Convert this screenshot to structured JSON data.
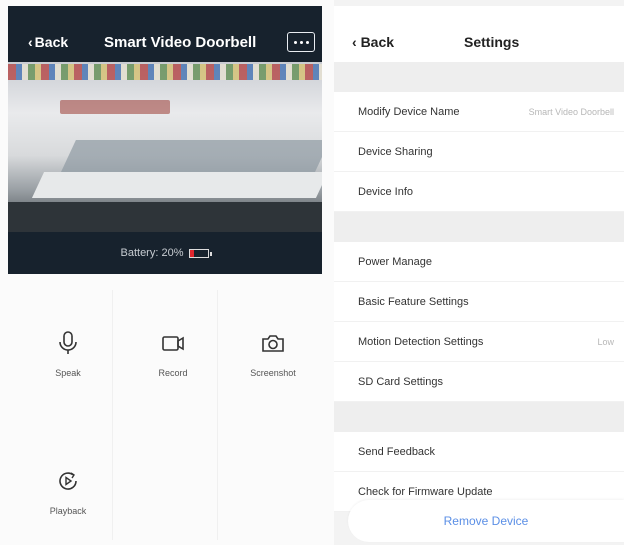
{
  "left_screen": {
    "back_label": "Back",
    "title": "Smart Video Doorbell",
    "battery_text": "Battery: 20%",
    "battery_level": 0.2,
    "battery_color": "#e0262e",
    "controls": [
      {
        "label": "Speak",
        "icon": "microphone-icon"
      },
      {
        "label": "Record",
        "icon": "video-camera-icon"
      },
      {
        "label": "Screenshot",
        "icon": "camera-icon"
      },
      {
        "label": "Playback",
        "icon": "playback-icon"
      }
    ]
  },
  "right_screen": {
    "back_label": "Back",
    "title": "Settings",
    "rows": [
      {
        "label": "Modify Device Name",
        "value": "Smart Video Doorbell"
      },
      {
        "label": "Device Sharing",
        "value": ""
      },
      {
        "label": "Device Info",
        "value": ""
      },
      {
        "label": "Power Manage",
        "value": ""
      },
      {
        "label": "Basic Feature Settings",
        "value": ""
      },
      {
        "label": "Motion Detection Settings",
        "value": "Low"
      },
      {
        "label": "SD Card Settings",
        "value": ""
      },
      {
        "label": "Send Feedback",
        "value": ""
      },
      {
        "label": "Check for Firmware Update",
        "value": ""
      }
    ],
    "remove_button": "Remove Device",
    "accent_color": "#5b8fe6"
  }
}
